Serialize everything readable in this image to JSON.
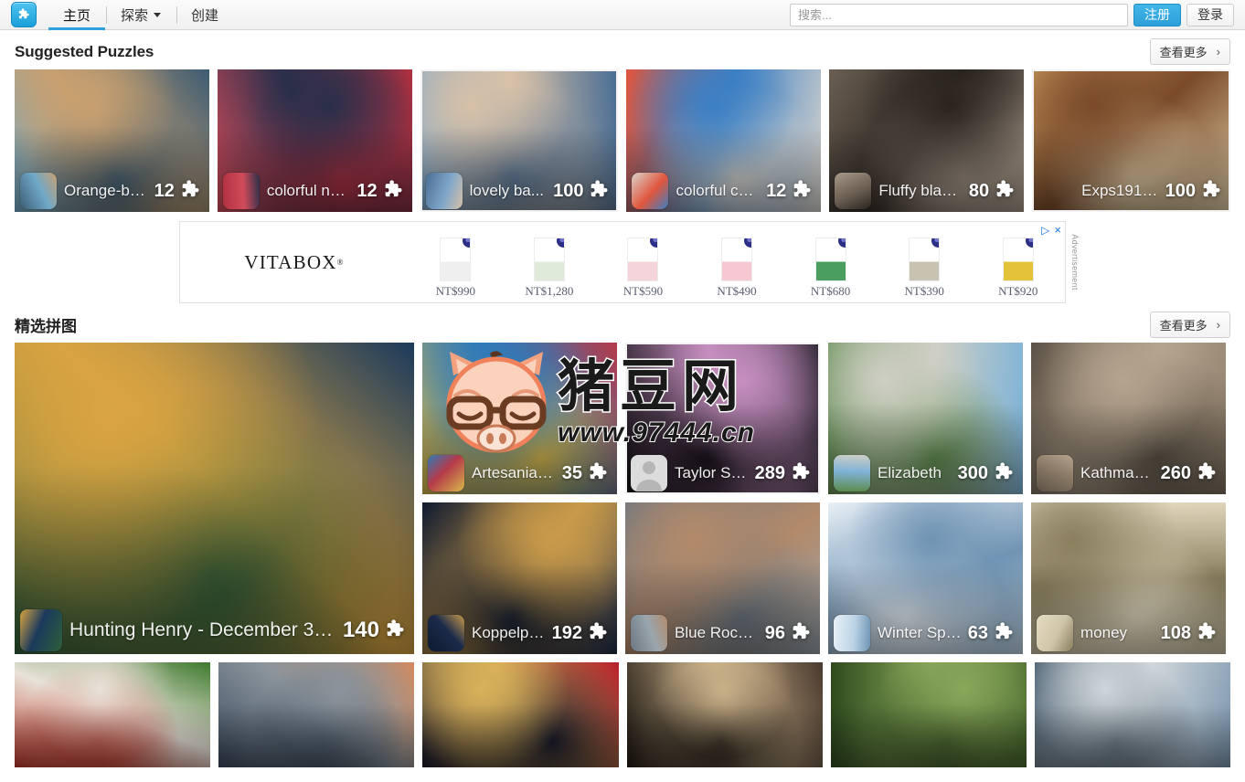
{
  "header": {
    "logo_alt": "jigsaw-logo",
    "nav": [
      {
        "label": "主页",
        "active": true,
        "has_caret": false
      },
      {
        "label": "探索",
        "active": false,
        "has_caret": true
      },
      {
        "label": "创建",
        "active": false,
        "has_caret": false
      }
    ],
    "search_placeholder": "搜索...",
    "search_value": "",
    "register_label": "注册",
    "login_label": "登录"
  },
  "accent_color": "#2ca3dd",
  "sections": [
    {
      "title": "Suggested Puzzles",
      "see_more_label": "查看更多",
      "see_more_chevron": "›"
    },
    {
      "title": "精选拼图",
      "see_more_label": "查看更多",
      "see_more_chevron": "›"
    }
  ],
  "suggested_puzzles": [
    {
      "title": "Orange-be...",
      "pieces": "12",
      "avatar": "woman-portrait-avatar",
      "img": "pier-sunset-beach",
      "c1": "#6fa8c8",
      "c2": "#c8a070",
      "c3": "#3d5c73"
    },
    {
      "title": "colorful ne...",
      "pieces": "12",
      "avatar": "rose-avatar",
      "img": "colorful-beaded-necklaces",
      "c1": "#d14b5a",
      "c2": "#2a2f4a",
      "c3": "#b03040"
    },
    {
      "title": "lovely ba...",
      "pieces": "100",
      "avatar": "egyptian-art-avatar",
      "img": "baby-in-headscarf",
      "c1": "#7fa6c9",
      "c2": "#d7c1a8",
      "c3": "#4b6e94"
    },
    {
      "title": "colorful chair",
      "pieces": "12",
      "avatar": "rose-avatar",
      "img": "colorful-metal-stools",
      "c1": "#e0563d",
      "c2": "#3b7fc4",
      "c3": "#d9d4cc"
    },
    {
      "title": "Fluffy black...",
      "pieces": "80",
      "avatar": "black-cat-poster-avatar",
      "img": "black-cat-on-porch",
      "c1": "#6b5f52",
      "c2": "#2a241f",
      "c3": "#a8998a"
    },
    {
      "title": "Exps191564 S1...",
      "pieces": "100",
      "avatar": "none",
      "img": "bread-bowl-soup",
      "c1": "#c89a5e",
      "c2": "#7a4a2a",
      "c3": "#e3cfa8"
    }
  ],
  "featured_puzzles": [
    {
      "title": "Hunting Henry - December 31...",
      "pieces": "140",
      "avatar": "chicken-avatar",
      "img": "christmas-shop-interior",
      "c1": "#1b3a5c",
      "c2": "#d9a441",
      "c3": "#2e5f3a",
      "big": true
    },
    {
      "title": "Artesania l...",
      "pieces": "35",
      "avatar": "music-notes-avatar",
      "img": "artisan-craft-market",
      "c1": "#b53a4a",
      "c2": "#2f7ab8",
      "c3": "#d9b84a"
    },
    {
      "title": "Taylor Swift",
      "pieces": "289",
      "avatar": "default-user-avatar",
      "img": "singer-in-pink-gown",
      "c1": "#2a2430",
      "c2": "#c58ebf",
      "c3": "#120f14"
    },
    {
      "title": "Elizabeth",
      "pieces": "300",
      "avatar": "tiger-avatar",
      "img": "suburban-street-houses",
      "c1": "#7fb3d8",
      "c2": "#cfcfc4",
      "c3": "#5b8a4a"
    },
    {
      "title": "Kathmandu",
      "pieces": "260",
      "avatar": "tiger-avatar",
      "img": "narrow-city-alley",
      "c1": "#8a7a66",
      "c2": "#b5a48e",
      "c3": "#5c5246"
    },
    {
      "title": "Koppelpo...",
      "pieces": "192",
      "avatar": "bald-man-avatar",
      "img": "castle-at-dusk",
      "c1": "#1b2a4a",
      "c2": "#c89a4a",
      "c3": "#0f1a30"
    },
    {
      "title": "Blue Rocks,...",
      "pieces": "96",
      "avatar": "bearded-man-avatar",
      "img": "fishing-shacks-shore",
      "c1": "#9aa6ae",
      "c2": "#b38a6a",
      "c3": "#6b7680"
    },
    {
      "title": "Winter Spa...",
      "pieces": "63",
      "avatar": "cat-on-blanket-avatar",
      "img": "winter-mountain-hiker",
      "c1": "#bcd4e6",
      "c2": "#6f93b3",
      "c3": "#e8f0f6"
    },
    {
      "title": "money",
      "pieces": "108",
      "avatar": "woman-avatar",
      "img": "rolled-dollar-bills",
      "c1": "#cfc5a8",
      "c2": "#8a7f5e",
      "c3": "#e5dcc2"
    }
  ],
  "bottom_row_puzzles": [
    {
      "img": "painted-teapots",
      "c1": "#3f7a2e",
      "c2": "#e8e2d8",
      "c3": "#c0392b"
    },
    {
      "img": "vintage-train-274",
      "c1": "#d98a5a",
      "c2": "#8a949c",
      "c3": "#3a4a5c"
    },
    {
      "img": "venetian-carnival-masks",
      "c1": "#b5202a",
      "c2": "#d9b15a",
      "c3": "#1a1a2a"
    },
    {
      "img": "historical-costume-group",
      "c1": "#4a3a2e",
      "c2": "#c9b089",
      "c3": "#1e1812"
    },
    {
      "img": "garden-cactus-wheel",
      "c1": "#4a6a2e",
      "c2": "#8aa85a",
      "c3": "#2e4a1e"
    },
    {
      "img": "classic-car-motel",
      "c1": "#7a95ad",
      "c2": "#cfd6da",
      "c3": "#4a5f70"
    }
  ],
  "advertisement": {
    "brand": "VITABOX",
    "brand_mark": "®",
    "label": "Advertisement",
    "adchoices_icon": "adchoices-triangle-icon",
    "close_icon": "×",
    "products": [
      {
        "price": "NT$990",
        "thumb": "supplement-box-white",
        "c1": "#ffffff",
        "c2": "#efefef"
      },
      {
        "price": "NT$1,280",
        "thumb": "supplement-box-green",
        "c1": "#ffffff",
        "c2": "#dfeadb"
      },
      {
        "price": "NT$590",
        "thumb": "supplement-box-pink",
        "c1": "#ffffff",
        "c2": "#f4d4d8"
      },
      {
        "price": "NT$490",
        "thumb": "supplement-box-rose",
        "c1": "#ffffff",
        "c2": "#f6c9d2"
      },
      {
        "price": "NT$680",
        "thumb": "supplement-pouch-green",
        "c1": "#ffffff",
        "c2": "#4a9e5e"
      },
      {
        "price": "NT$390",
        "thumb": "supplement-pouch-beige",
        "c1": "#ffffff",
        "c2": "#c8c3b0"
      },
      {
        "price": "NT$920",
        "thumb": "supplement-pouch-yellow",
        "c1": "#ffffff",
        "c2": "#e3c33a"
      }
    ]
  },
  "watermark": {
    "text_cn": "猪豆网",
    "url": "www.97444.cn",
    "mascot": "pig-with-glasses-icon"
  }
}
